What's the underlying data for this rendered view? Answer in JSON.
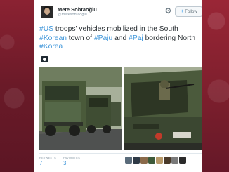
{
  "user": {
    "name": "Mete Sohtaoğlu",
    "handle": "@metesohtaoglu"
  },
  "follow_button": {
    "label": "Follow"
  },
  "tweet": {
    "segments": [
      {
        "text": "#US",
        "hashtag": true
      },
      {
        "text": " troops' vehicles mobilized in the South ",
        "hashtag": false
      },
      {
        "text": "#Korean",
        "hashtag": true
      },
      {
        "text": " town of ",
        "hashtag": false
      },
      {
        "text": "#Paju",
        "hashtag": true
      },
      {
        "text": " and ",
        "hashtag": false
      },
      {
        "text": "#Paj",
        "hashtag": true
      },
      {
        "text": " bordering North ",
        "hashtag": false
      },
      {
        "text": "#Korea",
        "hashtag": true
      }
    ]
  },
  "metrics": {
    "retweets_label": "RETWEETS",
    "retweets": "7",
    "favorites_label": "FAVORITES",
    "favorites": "3"
  },
  "colors": {
    "hashtag": "#3b94d9",
    "text": "#292f33",
    "muted": "#8899a6",
    "background": "#7a1f2e"
  },
  "icons": {
    "settings": "gear-icon",
    "follow": "add-user-icon",
    "media": "camera-icon"
  }
}
